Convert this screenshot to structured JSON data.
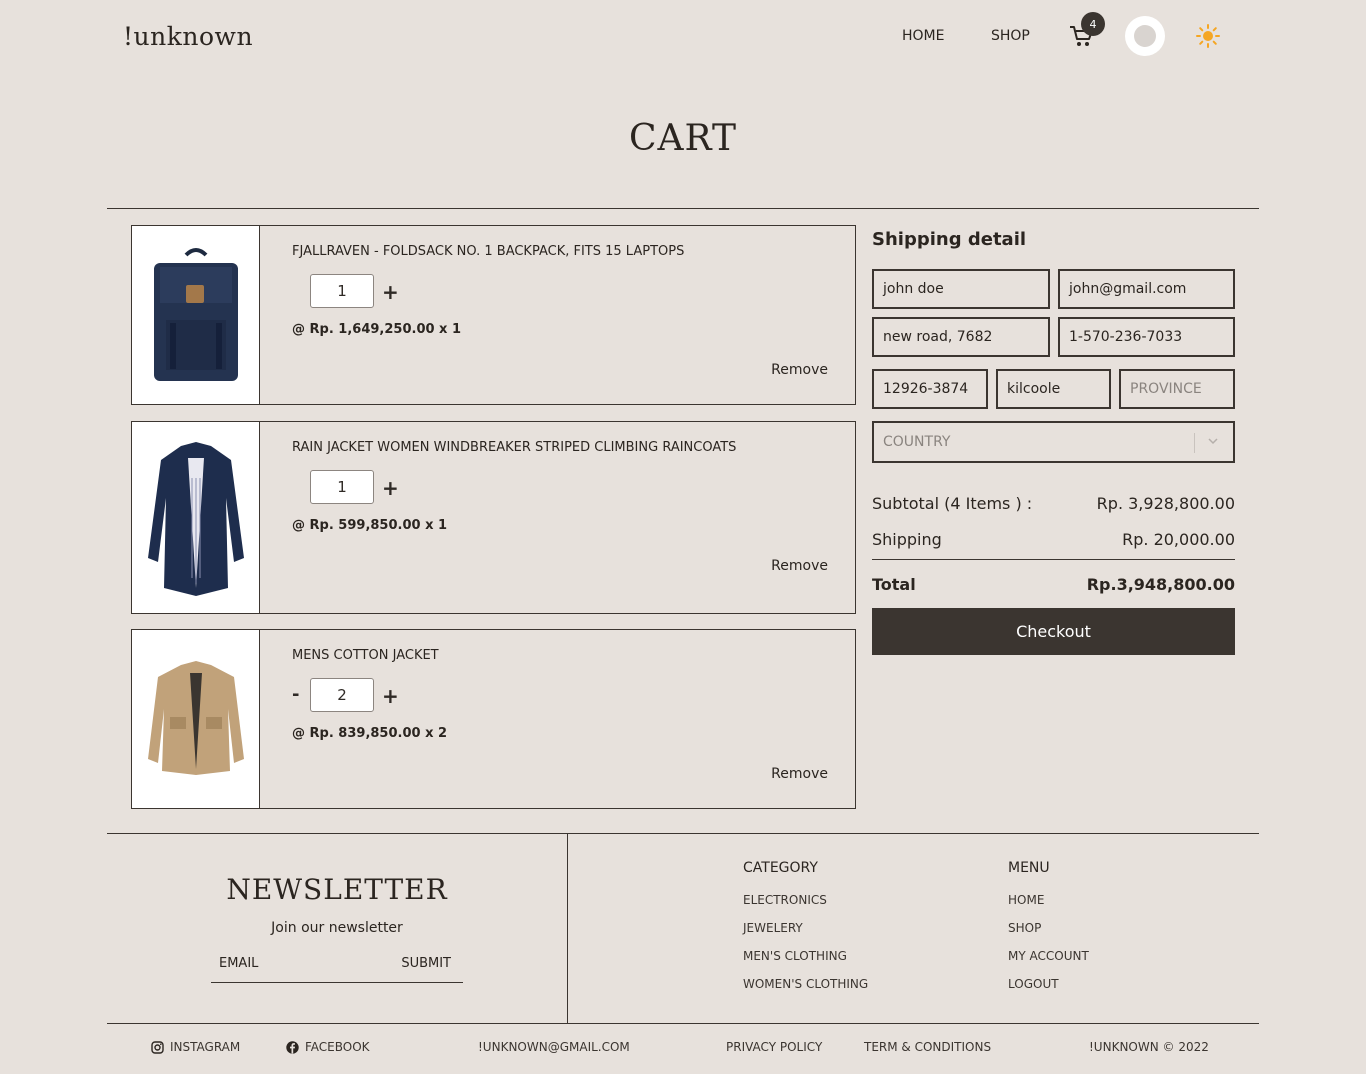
{
  "header": {
    "logo": "!unknown",
    "nav": [
      "HOME",
      "SHOP"
    ],
    "cart_count": "4"
  },
  "page_title": "CART",
  "items": [
    {
      "name": "FJALLRAVEN - FOLDSACK NO. 1 BACKPACK, FITS 15 LAPTOPS",
      "qty": "1",
      "price": "@ Rp. 1,649,250.00 x 1",
      "remove": "Remove",
      "minus": ""
    },
    {
      "name": "RAIN JACKET WOMEN WINDBREAKER STRIPED CLIMBING RAINCOATS",
      "qty": "1",
      "price": "@ Rp. 599,850.00 x 1",
      "remove": "Remove",
      "minus": ""
    },
    {
      "name": "MENS COTTON JACKET",
      "qty": "2",
      "price": "@ Rp. 839,850.00 x 2",
      "remove": "Remove",
      "minus": "-"
    }
  ],
  "qty_plus": "+",
  "shipping": {
    "title": "Shipping detail",
    "name": "john doe",
    "email": "john@gmail.com",
    "address": "new road, 7682",
    "phone": "1-570-236-7033",
    "zip": "12926-3874",
    "city": "kilcoole",
    "province_placeholder": "PROVINCE",
    "country_placeholder": "COUNTRY"
  },
  "summary": {
    "subtotal_label": "Subtotal (4 Items ) :",
    "subtotal_value": "Rp. 3,928,800.00",
    "shipping_label": "Shipping",
    "shipping_value": "Rp. 20,000.00",
    "total_label": "Total",
    "total_value": "Rp.3,948,800.00",
    "checkout": "Checkout"
  },
  "footer": {
    "newsletter_title": "NEWSLETTER",
    "newsletter_sub": "Join our newsletter",
    "email_placeholder": "EMAIL",
    "submit": "SUBMIT",
    "category_title": "CATEGORY",
    "categories": [
      "ELECTRONICS",
      "JEWELERY",
      "MEN'S CLOTHING",
      "WOMEN'S CLOTHING"
    ],
    "menu_title": "MENU",
    "menu": [
      "HOME",
      "SHOP",
      "MY ACCOUNT",
      "LOGOUT"
    ],
    "instagram": "INSTAGRAM",
    "facebook": "FACEBOOK",
    "contact_email": "!UNKNOWN@GMAIL.COM",
    "privacy": "PRIVACY POLICY",
    "terms": "TERM & CONDITIONS",
    "copyright": "!UNKNOWN © 2022"
  },
  "colors": {
    "background": "#e7e1dc",
    "dark": "#3b3530",
    "sun": "#f5a623"
  }
}
